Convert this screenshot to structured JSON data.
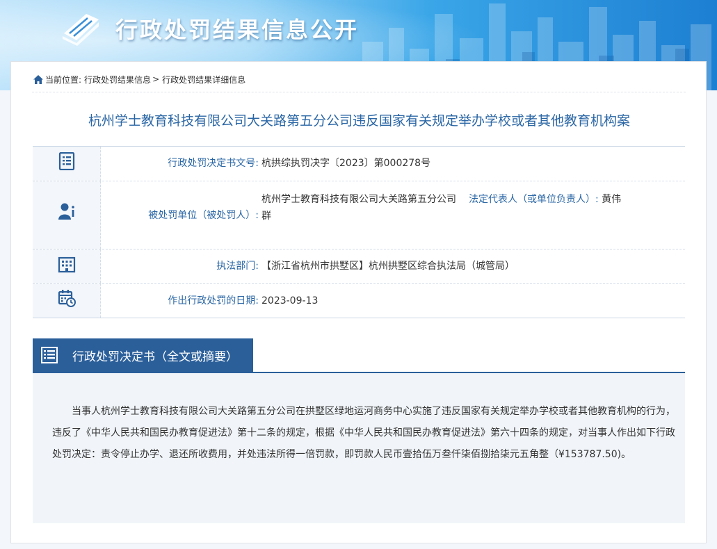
{
  "banner": {
    "title": "行政处罚结果信息公开",
    "logo_icon": "book-icon"
  },
  "breadcrumb": {
    "label": "当前位置:",
    "items": [
      "行政处罚结果信息",
      "行政处罚结果详细信息"
    ],
    "separator": ">"
  },
  "case_title": "杭州学士教育科技有限公司大关路第五分公司违反国家有关规定举办学校或者其他教育机构案",
  "info": {
    "decision_no": {
      "icon": "document-icon",
      "label": "行政处罚决定书文号:",
      "value": "杭拱综执罚决字〔2023〕第000278号"
    },
    "penalized": {
      "icon": "person-icon",
      "label": "被处罚单位（被处罚人）:",
      "value": "杭州学士教育科技有限公司大关路第五分公司",
      "rep_label": "法定代表人（或单位负责人）:",
      "rep_value_a": "黄伟",
      "rep_value_b": "群"
    },
    "department": {
      "icon": "building-icon",
      "label": "执法部门:",
      "value": "【浙江省杭州市拱墅区】杭州拱墅区综合执法局（城管局）"
    },
    "date": {
      "icon": "calendar-clock-icon",
      "label": "作出行政处罚的日期:",
      "value": "2023-09-13"
    }
  },
  "decision": {
    "title": "行政处罚决定书（全文或摘要）",
    "icon": "document-list-icon",
    "text": "当事人杭州学士教育科技有限公司大关路第五分公司在拱墅区绿地运河商务中心实施了违反国家有关规定举办学校或者其他教育机构的行为，违反了《中华人民共和国民办教育促进法》第十二条的规定，根据《中华人民共和国民办教育促进法》第六十四条的规定，对当事人作出如下行政处罚决定：责令停止办学、退还所收费用，并处违法所得一倍罚款，即罚款人民币壹拾伍万叁仟柒佰捌拾柒元五角整（¥153787.50)。"
  },
  "colors": {
    "accent": "#2b5f9a",
    "label_blue": "#2a66a5",
    "panel_bg": "#f1f5f9"
  }
}
